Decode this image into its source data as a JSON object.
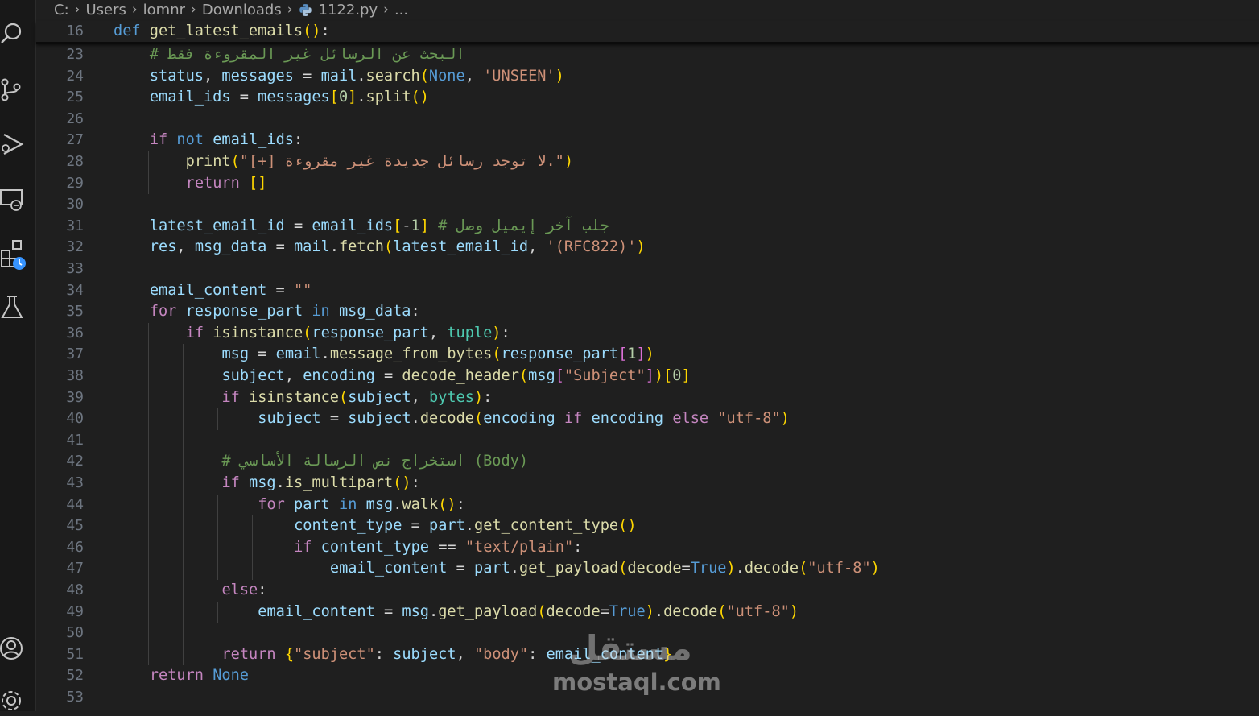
{
  "breadcrumb": {
    "items": [
      "C:",
      "Users",
      "lomnr",
      "Downloads",
      "1122.py",
      "..."
    ]
  },
  "editor": {
    "sticky_line": {
      "number": "16",
      "text": "def get_latest_emails():"
    },
    "lines": [
      {
        "n": "23",
        "text": "    # البحث عن الرسائل غير المقروءة فقط"
      },
      {
        "n": "24",
        "text": "    status, messages = mail.search(None, 'UNSEEN')"
      },
      {
        "n": "25",
        "text": "    email_ids = messages[0].split()"
      },
      {
        "n": "26",
        "text": ""
      },
      {
        "n": "27",
        "text": "    if not email_ids:"
      },
      {
        "n": "28",
        "text": "        print(\"[+] لا توجد رسائل جديدة غير مقروءة.\")"
      },
      {
        "n": "29",
        "text": "        return []"
      },
      {
        "n": "30",
        "text": ""
      },
      {
        "n": "31",
        "text": "    latest_email_id = email_ids[-1] # جلب آخر إيميل وصل"
      },
      {
        "n": "32",
        "text": "    res, msg_data = mail.fetch(latest_email_id, '(RFC822)')"
      },
      {
        "n": "33",
        "text": ""
      },
      {
        "n": "34",
        "text": "    email_content = \"\""
      },
      {
        "n": "35",
        "text": "    for response_part in msg_data:"
      },
      {
        "n": "36",
        "text": "        if isinstance(response_part, tuple):"
      },
      {
        "n": "37",
        "text": "            msg = email.message_from_bytes(response_part[1])"
      },
      {
        "n": "38",
        "text": "            subject, encoding = decode_header(msg[\"Subject\"])[0]"
      },
      {
        "n": "39",
        "text": "            if isinstance(subject, bytes):"
      },
      {
        "n": "40",
        "text": "                subject = subject.decode(encoding if encoding else \"utf-8\")"
      },
      {
        "n": "41",
        "text": ""
      },
      {
        "n": "42",
        "text": "            # استخراج نص الرسالة الأساسي (Body)"
      },
      {
        "n": "43",
        "text": "            if msg.is_multipart():"
      },
      {
        "n": "44",
        "text": "                for part in msg.walk():"
      },
      {
        "n": "45",
        "text": "                    content_type = part.get_content_type()"
      },
      {
        "n": "46",
        "text": "                    if content_type == \"text/plain\":"
      },
      {
        "n": "47",
        "text": "                        email_content = part.get_payload(decode=True).decode(\"utf-8\")"
      },
      {
        "n": "48",
        "text": "            else:"
      },
      {
        "n": "49",
        "text": "                email_content = msg.get_payload(decode=True).decode(\"utf-8\")"
      },
      {
        "n": "50",
        "text": ""
      },
      {
        "n": "51",
        "text": "            return {\"subject\": subject, \"body\": email_content}"
      },
      {
        "n": "52",
        "text": "    return None"
      },
      {
        "n": "53",
        "text": ""
      }
    ]
  },
  "activity_bar": {
    "icons": [
      "search-icon",
      "source-control-icon",
      "run-debug-icon",
      "remote-explorer-icon",
      "extensions-icon",
      "testing-icon",
      "account-icon",
      "settings-gear-icon"
    ]
  },
  "watermark": {
    "logo": "مستقل",
    "url": "mostaql.com"
  },
  "colors": {
    "keyword": "#569cd6",
    "control": "#c586c0",
    "function": "#dcdcaa",
    "variable": "#9cdcfe",
    "string": "#ce9178",
    "number": "#b5cea8",
    "comment": "#6a9955",
    "class": "#4ec9b0",
    "bracket1": "#ffd700",
    "bracket2": "#da70d6",
    "bracket3": "#179fff",
    "background": "#1f1f1f"
  }
}
